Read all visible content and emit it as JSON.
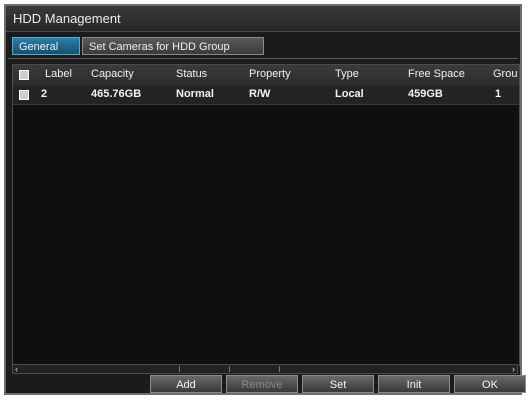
{
  "window": {
    "title": "HDD Management"
  },
  "tabs": [
    {
      "label": "General",
      "active": true
    },
    {
      "label": "Set Cameras for HDD Group",
      "active": false
    }
  ],
  "table": {
    "columns": [
      "Label",
      "Capacity",
      "Status",
      "Property",
      "Type",
      "Free Space",
      "Grou"
    ],
    "rows": [
      {
        "label": "2",
        "capacity": "465.76GB",
        "status": "Normal",
        "property": "R/W",
        "type": "Local",
        "free_space": "459GB",
        "group": "1"
      }
    ]
  },
  "buttons": {
    "add": "Add",
    "remove": "Remove",
    "set": "Set",
    "init": "Init",
    "ok": "OK"
  },
  "scroll": {
    "left_arrow": "‹",
    "right_arrow": "›"
  },
  "colors": {
    "active_tab": "#1f6f99",
    "background": "#1b1b1b"
  }
}
